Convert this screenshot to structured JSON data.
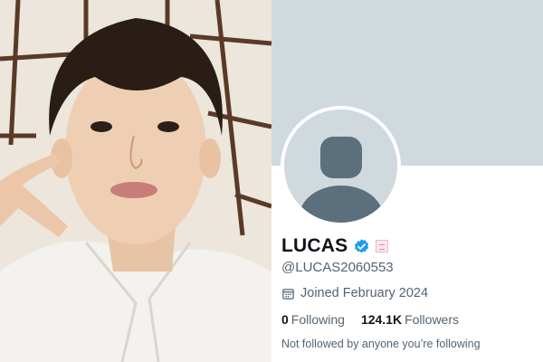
{
  "profile": {
    "display_name": "LUCAS",
    "verified": true,
    "handle": "@LUCAS2060553",
    "joined": "Joined February 2024",
    "following_count": "0",
    "following_label": "Following",
    "followers_count": "124.1K",
    "followers_label": "Followers",
    "followed_by_text": "Not followed by anyone you’re following"
  },
  "icons": {
    "verified": "verified-badge-icon",
    "calendar": "calendar-icon",
    "avatar": "default-avatar-icon"
  },
  "colors": {
    "banner": "#cfd9de",
    "verified": "#1d9bf0",
    "text_primary": "#0f1419",
    "text_secondary": "#536471"
  }
}
